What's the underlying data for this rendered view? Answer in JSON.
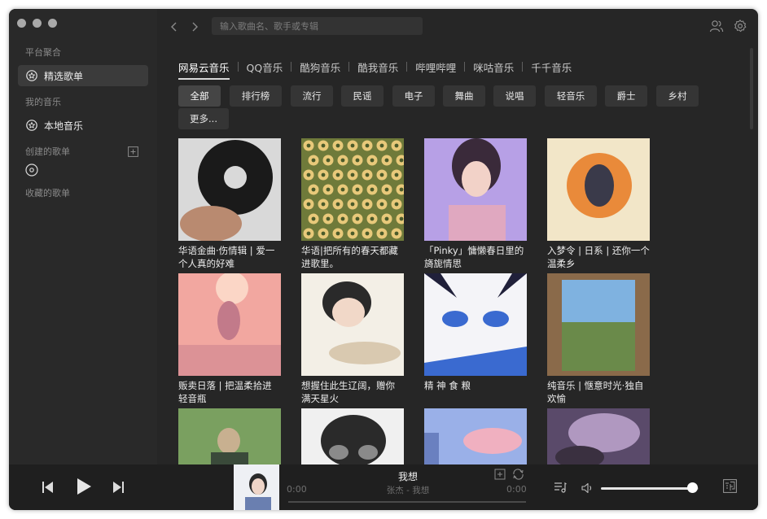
{
  "search": {
    "placeholder": "输入歌曲名、歌手或专辑"
  },
  "sidebar": {
    "sections": [
      {
        "heading": "平台聚合"
      },
      {
        "heading": "我的音乐"
      },
      {
        "heading": "创建的歌单"
      },
      {
        "heading": "收藏的歌单"
      }
    ],
    "items": [
      {
        "label": "精选歌单",
        "icon": "star-circle-icon",
        "active": true
      },
      {
        "label": "本地音乐",
        "icon": "star-circle-icon",
        "active": false
      }
    ]
  },
  "platform_tabs": [
    "网易云音乐",
    "QQ音乐",
    "酷狗音乐",
    "酷我音乐",
    "哔哩哔哩",
    "咪咕音乐",
    "千千音乐"
  ],
  "active_platform": "网易云音乐",
  "categories": [
    "全部",
    "排行榜",
    "流行",
    "民谣",
    "电子",
    "舞曲",
    "说唱",
    "轻音乐",
    "爵士",
    "乡村",
    "更多..."
  ],
  "active_category": "全部",
  "playlists": [
    {
      "title": "华语金曲·伤情辑 | 爱一个人真的好难",
      "palette": [
        "#d9d9d9",
        "#3a3a3a",
        "#1a1a1a"
      ]
    },
    {
      "title": "华语|把所有的春天都藏进歌里。",
      "palette": [
        "#6f7a3a",
        "#e8c97a",
        "#4a5a2a"
      ]
    },
    {
      "title": "「Pinky」慵懒春日里的旖旎情思",
      "palette": [
        "#b7a0e6",
        "#e0a8c0",
        "#3a2a3a"
      ]
    },
    {
      "title": "入梦令 | 日系 | 还你一个温柔乡",
      "palette": [
        "#f2e6c8",
        "#e98a3a",
        "#3a3a4a"
      ]
    },
    {
      "title": "贩卖日落 | 把温柔拾进轻音瓶",
      "palette": [
        "#f2a7a0",
        "#fbd6c6",
        "#c27a8a"
      ]
    },
    {
      "title": "想握住此生辽阔，赠你满天星火",
      "palette": [
        "#f3efe6",
        "#d9c9b0",
        "#2a2a2a"
      ]
    },
    {
      "title": "精 神 食 粮",
      "palette": [
        "#f4f4f8",
        "#3a6ad0",
        "#20203a"
      ]
    },
    {
      "title": "纯音乐 | 惬意时光·独自欢愉",
      "palette": [
        "#7fb2e0",
        "#6a8a4a",
        "#8a6a4a"
      ]
    },
    {
      "title": "",
      "palette": [
        "#7aa060",
        "#c8b090",
        "#3a4a3a"
      ]
    },
    {
      "title": "",
      "palette": [
        "#f0f0f0",
        "#2a2a2a",
        "#8a8a8a"
      ]
    },
    {
      "title": "",
      "palette": [
        "#9ab0e8",
        "#f0b0c0",
        "#6a80c0"
      ]
    },
    {
      "title": "",
      "palette": [
        "#5a4a6a",
        "#b098c0",
        "#3a3040"
      ]
    }
  ],
  "player": {
    "song": "我想",
    "artist_album": "张杰 - 我想",
    "elapsed": "0:00",
    "duration": "0:00",
    "progress": 0,
    "volume": 0.93
  },
  "colors": {
    "window": "#262626",
    "sidebar": "#292929",
    "player": "#1f1f1f",
    "chip": "#353535"
  }
}
